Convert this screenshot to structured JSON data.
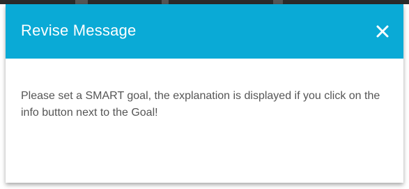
{
  "dialog": {
    "title": "Revise Message",
    "close_icon": "close-icon",
    "message": "Please set a SMART goal, the explanation is displayed if you click on the info button next to the Goal!"
  },
  "colors": {
    "header_background": "#0aaad6",
    "header_text": "#ffffff",
    "body_text": "#555555"
  }
}
